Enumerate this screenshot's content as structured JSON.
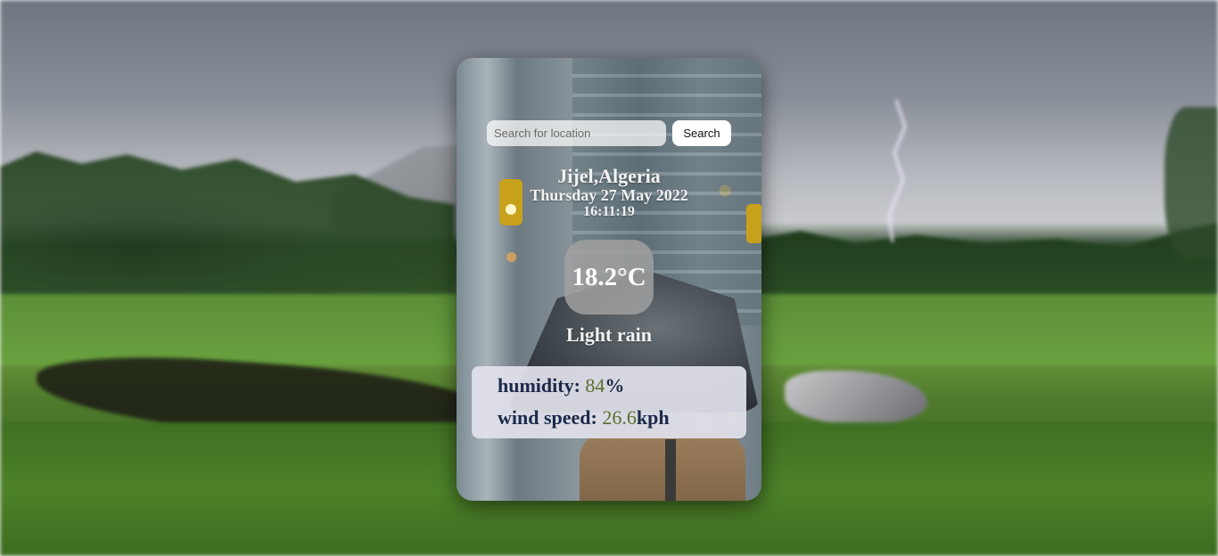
{
  "search": {
    "placeholder": "Search for location",
    "button_label": "Search"
  },
  "location": {
    "city": "Jijel,Algeria",
    "date": "Thursday 27 May 2022",
    "time": "16:11:19"
  },
  "weather": {
    "temperature": "18.2°C",
    "condition": "Light rain",
    "humidity_label": "humidity:",
    "humidity_value": "84",
    "humidity_unit": "%",
    "wind_label": "wind speed:",
    "wind_value": "26.6",
    "wind_unit": "kph"
  },
  "colors": {
    "stat_label": "#1c2a4a",
    "stat_value": "#5a6e2b",
    "stats_panel": "#e1e1eb"
  }
}
